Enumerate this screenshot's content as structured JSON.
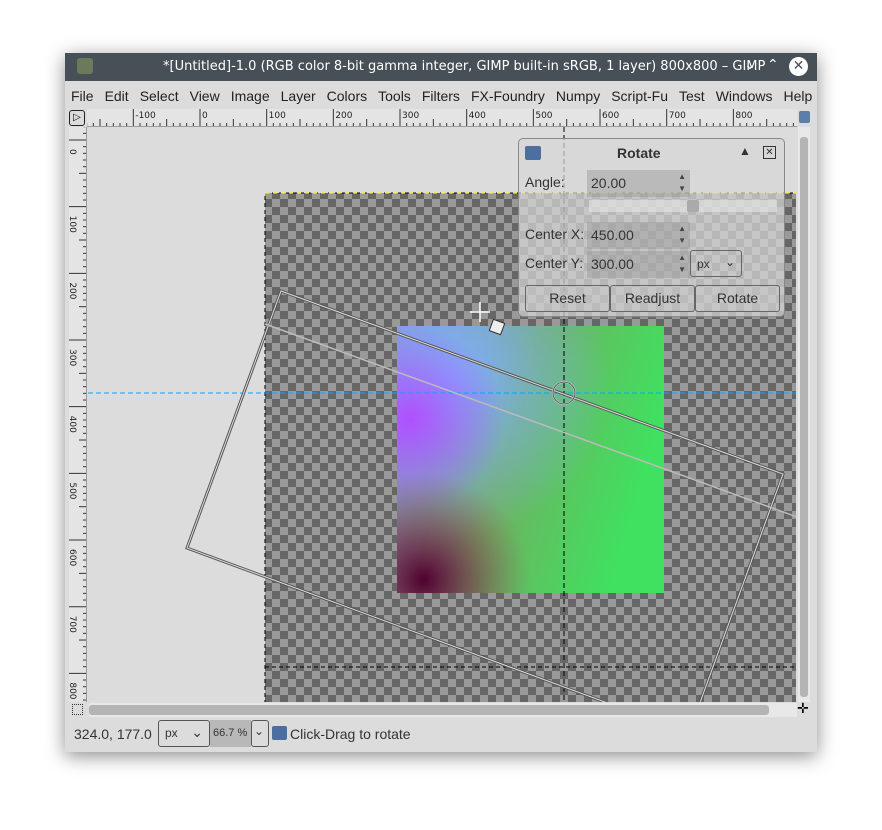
{
  "window": {
    "title": "*[Untitled]-1.0 (RGB color 8-bit gamma integer, GIMP built-in sRGB, 1 layer) 800x800 – GIMP"
  },
  "menu": [
    "File",
    "Edit",
    "Select",
    "View",
    "Image",
    "Layer",
    "Colors",
    "Tools",
    "Filters",
    "FX-Foundry",
    "Numpy",
    "Script-Fu",
    "Test",
    "Windows",
    "Help"
  ],
  "ruler": {
    "h_labels": [
      "-100",
      "0",
      "100",
      "200",
      "300",
      "400",
      "500",
      "600",
      "700",
      "800"
    ],
    "v_labels": [
      "0",
      "100",
      "200",
      "300",
      "400",
      "500",
      "600",
      "700",
      "800"
    ]
  },
  "rotate_dialog": {
    "title": "Rotate",
    "angle_label": "Angle:",
    "angle": "20.00",
    "center_x_label": "Center X:",
    "center_x": "450.00",
    "center_y_label": "Center Y:",
    "center_y": "300.00",
    "unit": "px",
    "reset": "Reset",
    "readjust": "Readjust",
    "rotate": "Rotate"
  },
  "status": {
    "coords": "324.0, 177.0",
    "unit": "px",
    "zoom": "66.7 %",
    "message": "Click-Drag to rotate"
  },
  "colors": {
    "titlebar": "#475057",
    "guide": "#00aaff",
    "selection": "#ffff00"
  }
}
